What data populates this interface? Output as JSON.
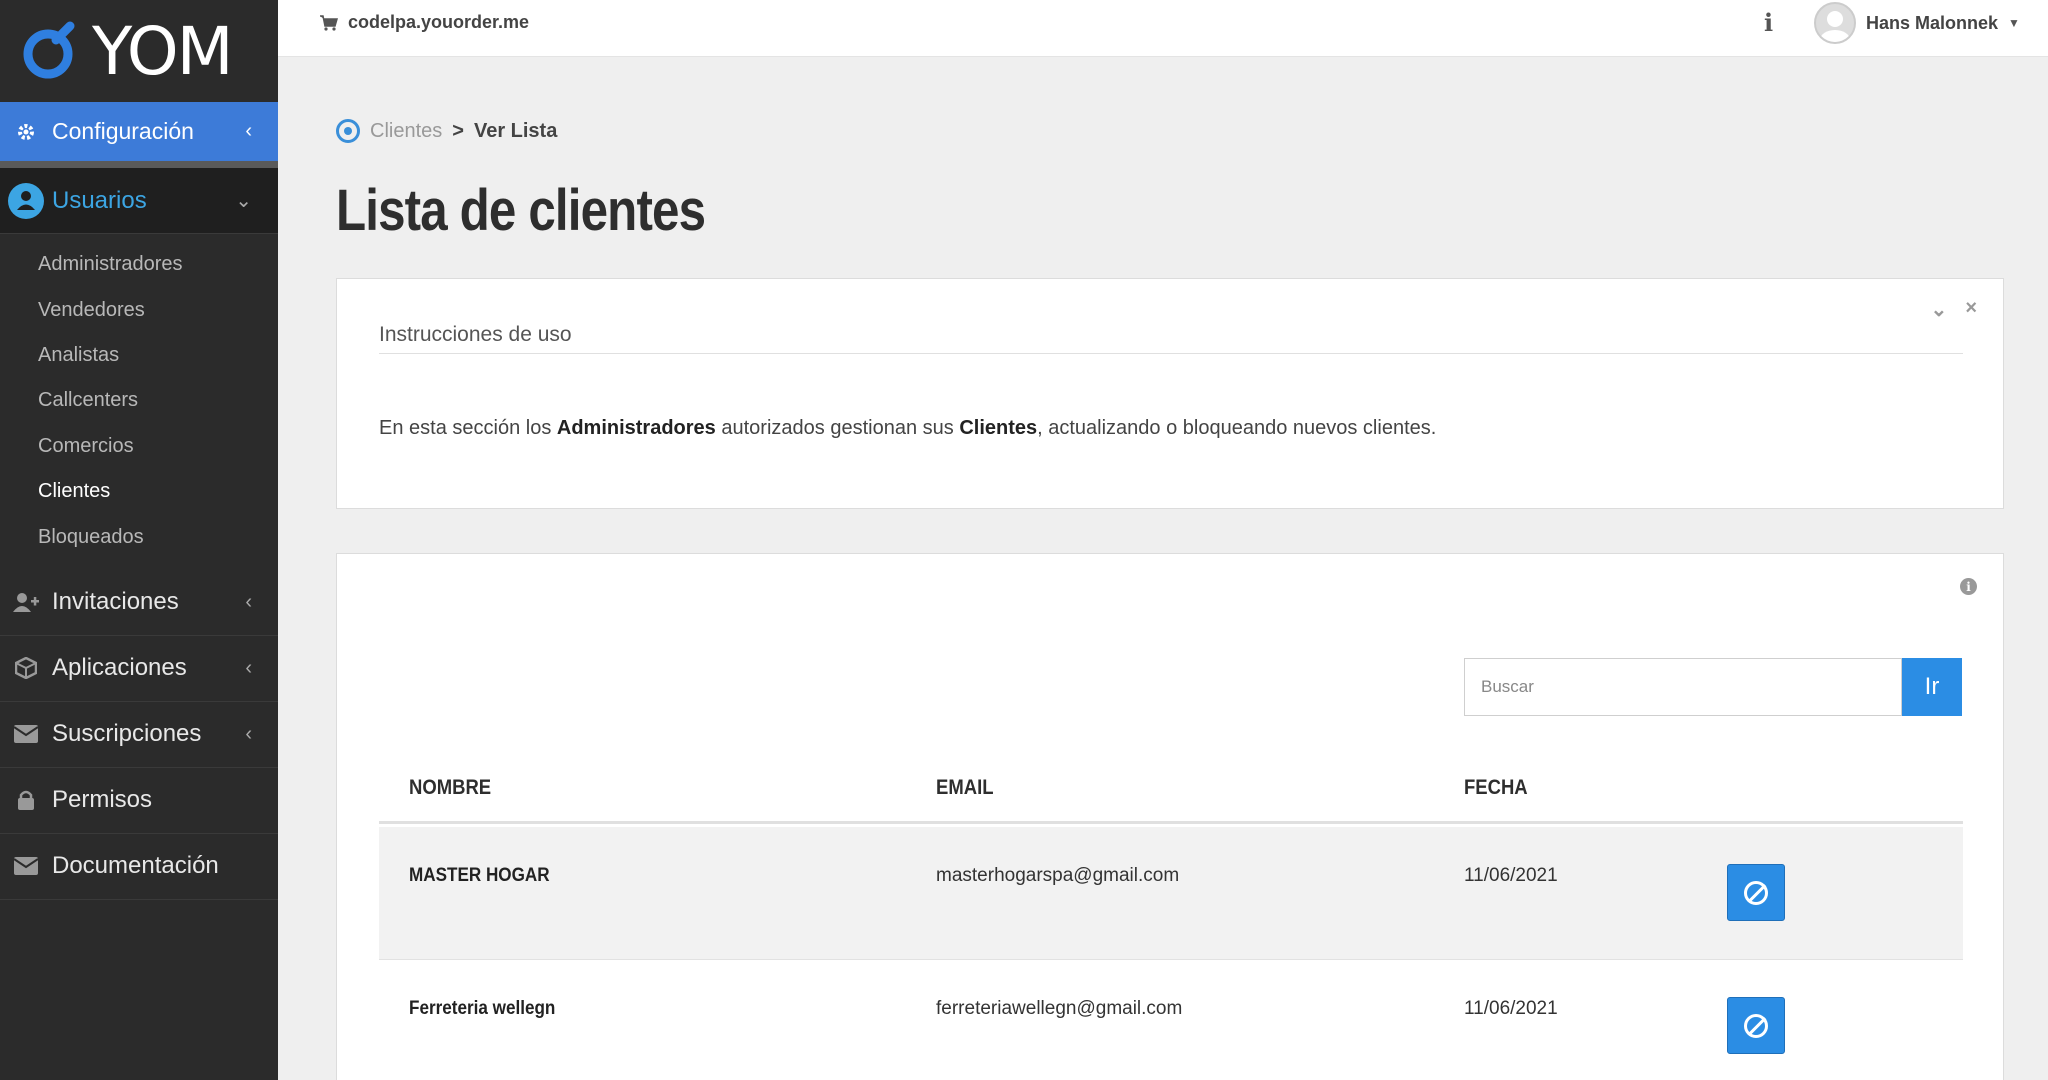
{
  "sidebar": {
    "logo_text": "YOM",
    "config_label": "Configuración",
    "users_label": "Usuarios",
    "users_sub": [
      "Administradores",
      "Vendedores",
      "Analistas",
      "Callcenters",
      "Comercios",
      "Clientes",
      "Bloqueados"
    ],
    "active_sub": "Clientes",
    "items": [
      {
        "label": "Invitaciones",
        "icon": "user-plus-icon",
        "has_chevron": true
      },
      {
        "label": "Aplicaciones",
        "icon": "cube-icon",
        "has_chevron": true
      },
      {
        "label": "Suscripciones",
        "icon": "envelope-icon",
        "has_chevron": true
      },
      {
        "label": "Permisos",
        "icon": "lock-icon",
        "has_chevron": false
      },
      {
        "label": "Documentación",
        "icon": "envelope-icon",
        "has_chevron": false
      }
    ]
  },
  "topbar": {
    "store_url": "codelpa.youorder.me",
    "user_name": "Hans Malonnek"
  },
  "breadcrumb": {
    "parent": "Clientes",
    "separator": ">",
    "current": "Ver Lista"
  },
  "page_title": "Lista de clientes",
  "instructions": {
    "title": "Instrucciones de uso",
    "text_before": "En esta sección los ",
    "bold1": "Administradores",
    "text_mid": " autorizados gestionan sus ",
    "bold2": "Clientes",
    "text_after": ", actualizando o bloqueando nuevos clientes."
  },
  "search": {
    "placeholder": "Buscar",
    "button_label": "Ir"
  },
  "table": {
    "headers": {
      "name": "NOMBRE",
      "email": "EMAIL",
      "date": "FECHA"
    },
    "rows": [
      {
        "name": "MASTER HOGAR",
        "email": "masterhogarspa@gmail.com",
        "date": "11/06/2021"
      },
      {
        "name": "Ferreteria wellegn",
        "email": "ferreteriawellegn@gmail.com",
        "date": "11/06/2021"
      }
    ]
  },
  "colors": {
    "accent": "#2b8de4",
    "sidebar_bg": "#2b2b2b",
    "config_bg": "#3d7bd8",
    "users_text": "#3ca5e3"
  }
}
